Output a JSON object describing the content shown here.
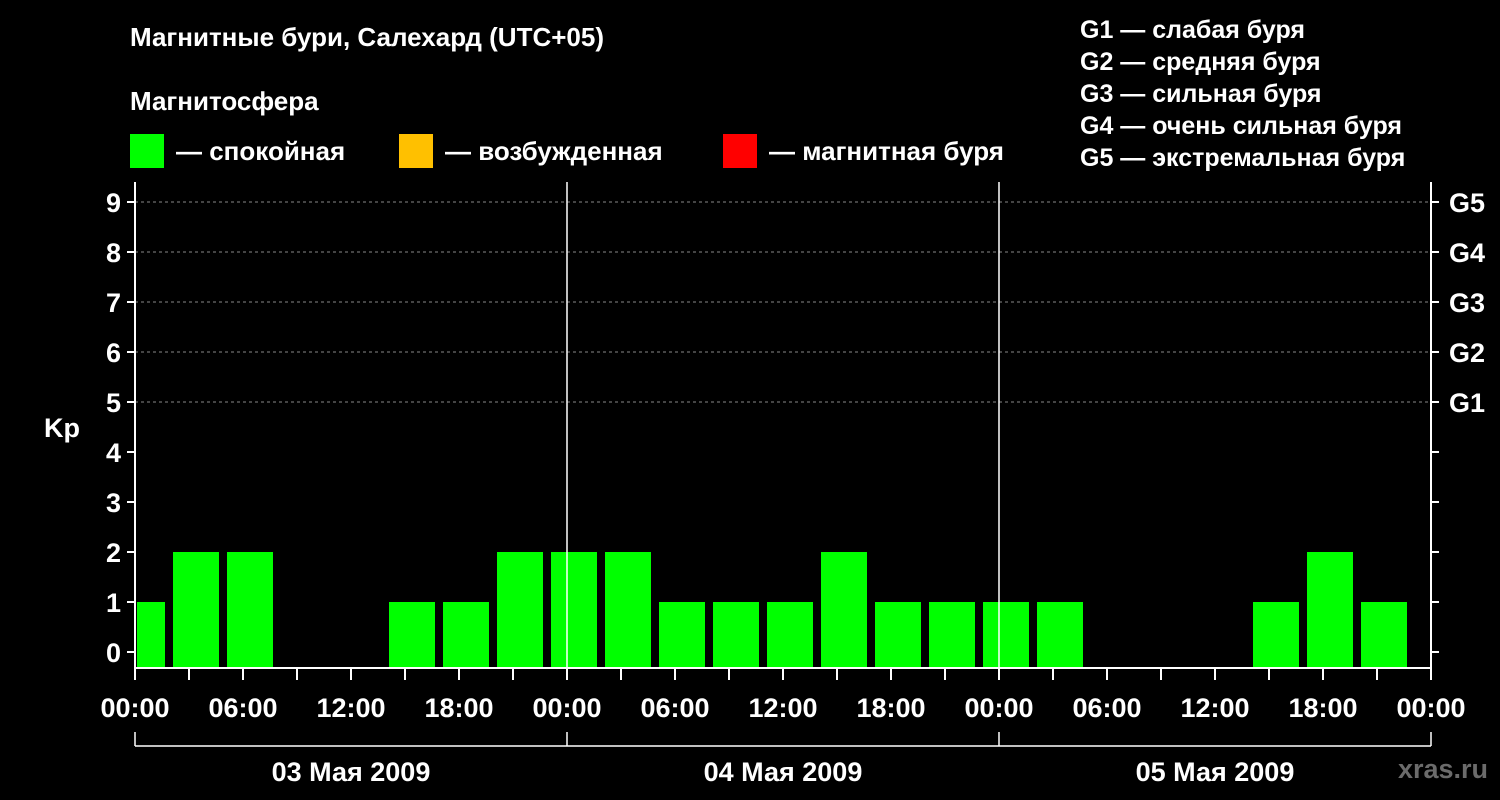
{
  "header": {
    "title": "Магнитные бури, Салехард (UTC+05)",
    "subtitle": "Магнитосфера"
  },
  "legend": [
    {
      "color": "#00ff00",
      "label": "— спокойная"
    },
    {
      "color": "#ffc000",
      "label": "— возбужденная"
    },
    {
      "color": "#ff0000",
      "label": "— магнитная буря"
    }
  ],
  "storm_levels": [
    "G1 — слабая буря",
    "G2 — средняя буря",
    "G3 — сильная буря",
    "G4 — очень сильная буря",
    "G5 — экстремальная буря"
  ],
  "watermark": "xras.ru",
  "chart_data": {
    "type": "bar",
    "ylabel": "Kp",
    "ylim": [
      0,
      9
    ],
    "yticks": [
      "0",
      "1",
      "2",
      "3",
      "4",
      "5",
      "6",
      "7",
      "8",
      "9"
    ],
    "right_axis_labels": [
      {
        "y": 5,
        "label": "G1"
      },
      {
        "y": 6,
        "label": "G2"
      },
      {
        "y": 7,
        "label": "G3"
      },
      {
        "y": 8,
        "label": "G4"
      },
      {
        "y": 9,
        "label": "G5"
      }
    ],
    "x_tick_labels": [
      "00:00",
      "06:00",
      "12:00",
      "18:00",
      "00:00",
      "06:00",
      "12:00",
      "18:00",
      "00:00",
      "06:00",
      "12:00",
      "18:00",
      "00:00"
    ],
    "days": [
      "03 Мая 2009",
      "04 Мая 2009",
      "05 Мая 2009"
    ],
    "x_range_hours": [
      0,
      72
    ],
    "grid": "horizontal dashed at 5-9",
    "bar_color": "#00ff00",
    "bars": [
      {
        "start_hour": 0,
        "end_hour": 2,
        "value": 1
      },
      {
        "start_hour": 2,
        "end_hour": 5,
        "value": 2
      },
      {
        "start_hour": 5,
        "end_hour": 8,
        "value": 2
      },
      {
        "start_hour": 8,
        "end_hour": 11,
        "value": 0
      },
      {
        "start_hour": 11,
        "end_hour": 14,
        "value": 0
      },
      {
        "start_hour": 14,
        "end_hour": 17,
        "value": 1
      },
      {
        "start_hour": 17,
        "end_hour": 20,
        "value": 1
      },
      {
        "start_hour": 20,
        "end_hour": 23,
        "value": 2
      },
      {
        "start_hour": 23,
        "end_hour": 26,
        "value": 2
      },
      {
        "start_hour": 26,
        "end_hour": 29,
        "value": 2
      },
      {
        "start_hour": 29,
        "end_hour": 32,
        "value": 1
      },
      {
        "start_hour": 32,
        "end_hour": 35,
        "value": 1
      },
      {
        "start_hour": 35,
        "end_hour": 38,
        "value": 1
      },
      {
        "start_hour": 38,
        "end_hour": 41,
        "value": 2
      },
      {
        "start_hour": 41,
        "end_hour": 44,
        "value": 1
      },
      {
        "start_hour": 44,
        "end_hour": 47,
        "value": 1
      },
      {
        "start_hour": 47,
        "end_hour": 50,
        "value": 1
      },
      {
        "start_hour": 50,
        "end_hour": 53,
        "value": 1
      },
      {
        "start_hour": 53,
        "end_hour": 56,
        "value": 0
      },
      {
        "start_hour": 56,
        "end_hour": 59,
        "value": 0
      },
      {
        "start_hour": 59,
        "end_hour": 62,
        "value": 0
      },
      {
        "start_hour": 62,
        "end_hour": 65,
        "value": 1
      },
      {
        "start_hour": 65,
        "end_hour": 68,
        "value": 2
      },
      {
        "start_hour": 68,
        "end_hour": 71,
        "value": 1
      }
    ]
  }
}
